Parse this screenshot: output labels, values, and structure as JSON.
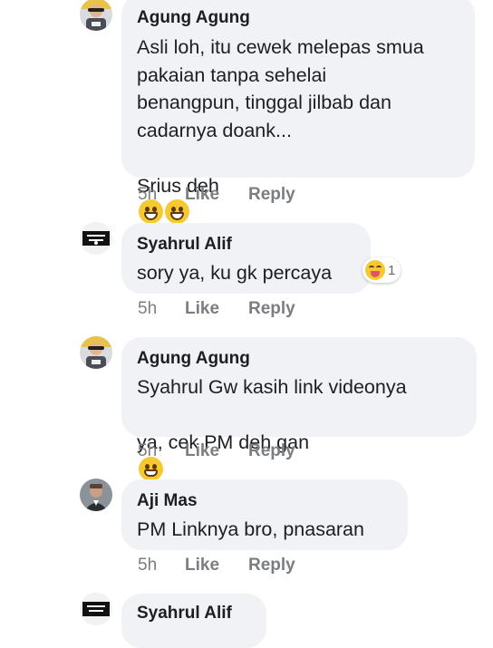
{
  "comments": [
    {
      "author": "Agung Agung",
      "lines": [
        "Asli loh, itu cewek melepas smua",
        "pakaian tanpa sehelai",
        "benangpun, tinggal jilbab dan",
        "cadarnya doank..."
      ],
      "last_line": "Srius deh",
      "time": "5h",
      "like": "Like",
      "reply": "Reply",
      "avatar": "sunglasses-person-avatar"
    },
    {
      "author": "Syahrul Alif",
      "text": "sory ya, ku gk percaya",
      "reaction_count": "1",
      "time": "5h",
      "like": "Like",
      "reply": "Reply",
      "avatar": "black-flag-avatar"
    },
    {
      "author": "Agung Agung",
      "lines": [
        "Syahrul Gw kasih link videonya"
      ],
      "last_line": "ya, cek PM deh gan",
      "time": "5h",
      "like": "Like",
      "reply": "Reply",
      "avatar": "sunglasses-person-avatar"
    },
    {
      "author": "Aji Mas",
      "text": "PM Linknya bro, pnasaran",
      "time": "5h",
      "like": "Like",
      "reply": "Reply",
      "avatar": "man-portrait-avatar"
    },
    {
      "author": "Syahrul Alif",
      "avatar": "black-flag-avatar"
    }
  ],
  "colors": {
    "bubble": "#f0f2f5",
    "action_text": "#7a7d82",
    "emoji": "#f7c930"
  }
}
